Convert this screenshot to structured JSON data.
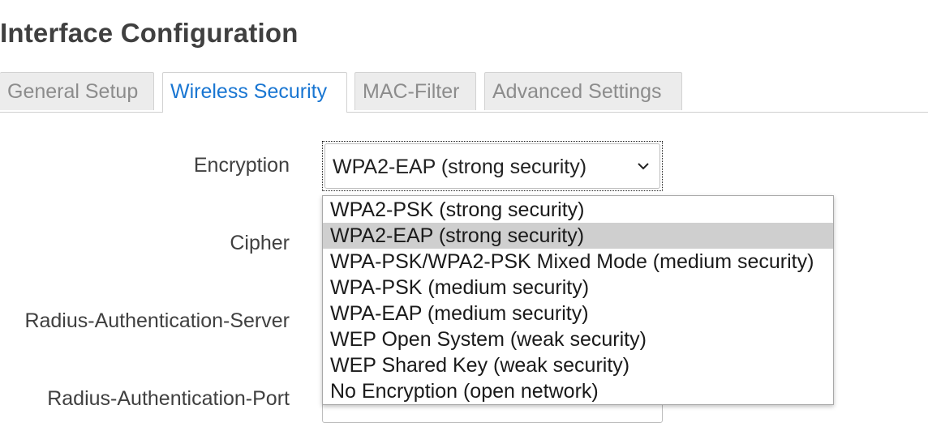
{
  "page": {
    "title": "Interface Configuration"
  },
  "tabs": [
    {
      "label": "General Setup",
      "active": false
    },
    {
      "label": "Wireless Security",
      "active": true
    },
    {
      "label": "MAC-Filter",
      "active": false
    },
    {
      "label": "Advanced Settings",
      "active": false
    }
  ],
  "form": {
    "encryption_label": "Encryption",
    "encryption_value": "WPA2-EAP (strong security)",
    "cipher_label": "Cipher",
    "radius_server_label": "Radius-Authentication-Server",
    "radius_port_label": "Radius-Authentication-Port"
  },
  "dropdown": {
    "selected_index": 1,
    "options": [
      "WPA2-PSK (strong security)",
      "WPA2-EAP (strong security)",
      "WPA-PSK/WPA2-PSK Mixed Mode (medium security)",
      "WPA-PSK (medium security)",
      "WPA-EAP (medium security)",
      "WEP Open System (weak security)",
      "WEP Shared Key (weak security)",
      "No Encryption (open network)"
    ]
  },
  "icons": {
    "select_arrow": "chevron-down-icon"
  },
  "colors": {
    "active_tab_text": "#1976d2",
    "inactive_tab_bg": "#ececec",
    "selected_option_bg": "#cfcfcf"
  }
}
